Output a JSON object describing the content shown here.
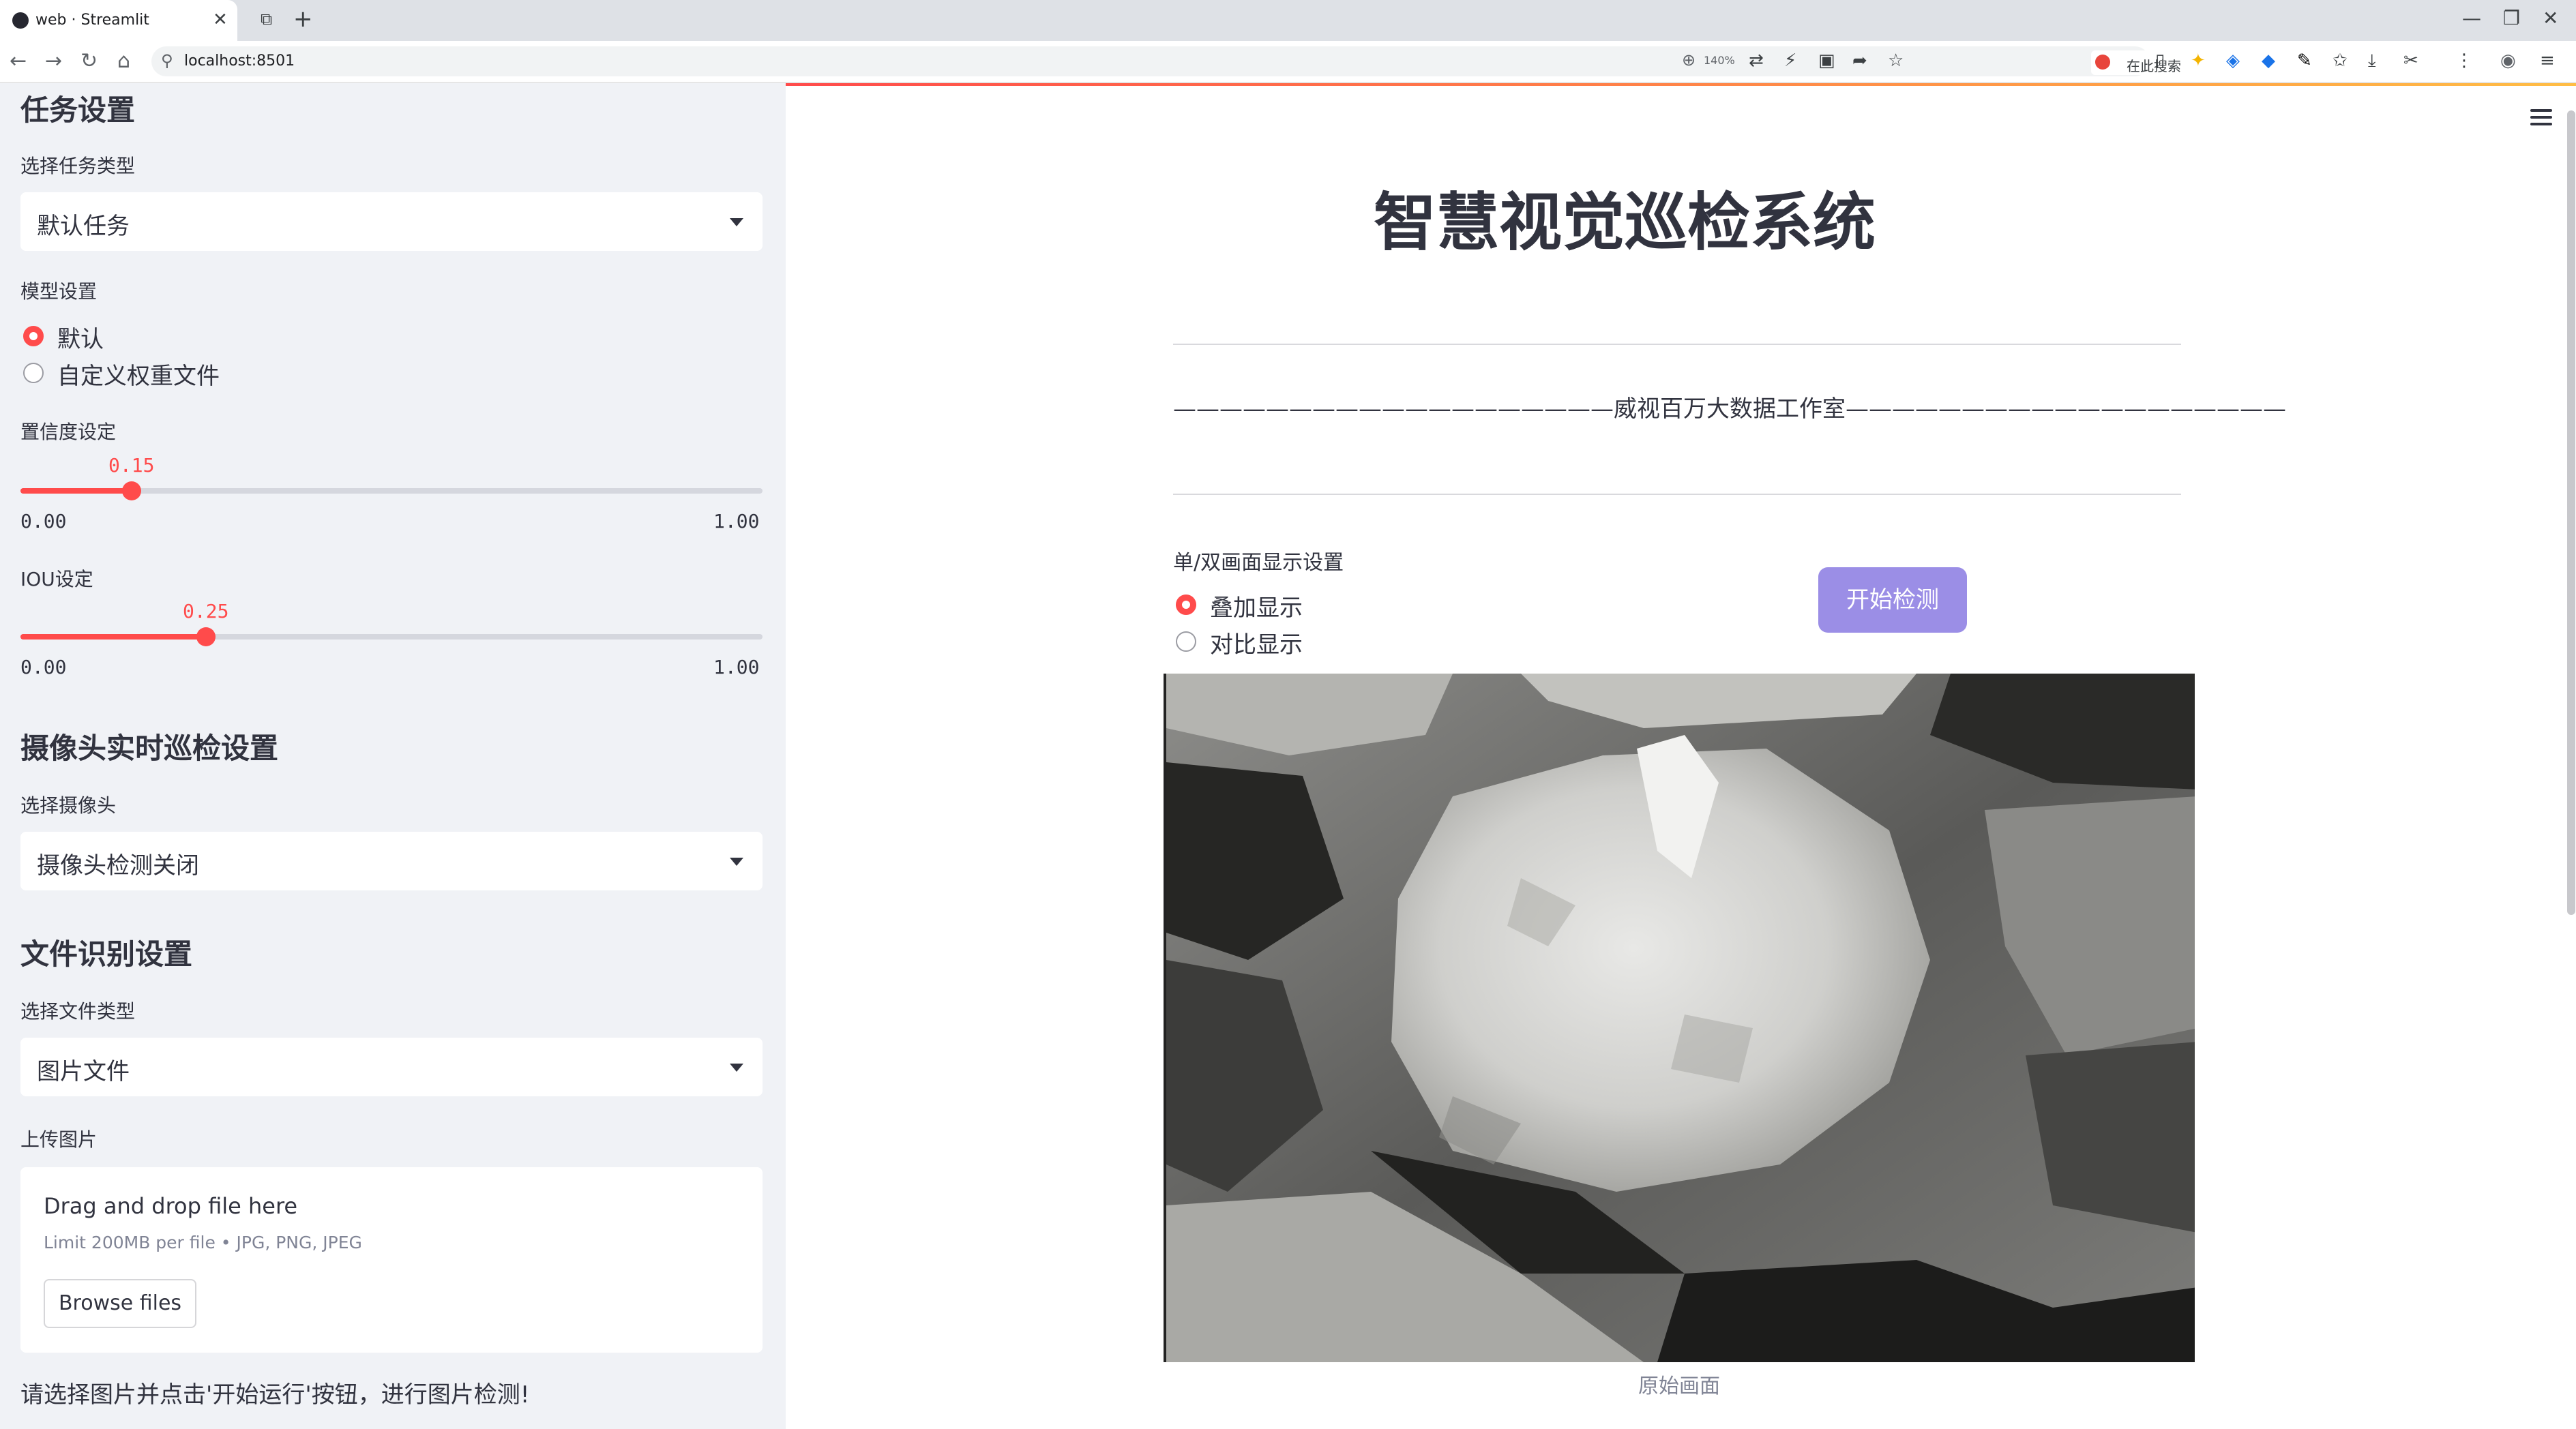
{
  "browser": {
    "tab_title": "web · Streamlit",
    "url": "localhost:8501",
    "zoom": "140%",
    "search_label": "在此搜索"
  },
  "sidebar": {
    "task_section_title": "任务设置",
    "task_type_label": "选择任务类型",
    "task_type_value": "默认任务",
    "model_label": "模型设置",
    "model_options": [
      "默认",
      "自定义权重文件"
    ],
    "model_selected": 0,
    "confidence_label": "置信度设定",
    "confidence": {
      "value": 0.15,
      "value_text": "0.15",
      "min_text": "0.00",
      "max_text": "1.00"
    },
    "iou_label": "IOU设定",
    "iou": {
      "value": 0.25,
      "value_text": "0.25",
      "min_text": "0.00",
      "max_text": "1.00"
    },
    "camera_section_title": "摄像头实时巡检设置",
    "camera_label": "选择摄像头",
    "camera_value": "摄像头检测关闭",
    "file_section_title": "文件识别设置",
    "file_type_label": "选择文件类型",
    "file_type_value": "图片文件",
    "upload_label": "上传图片",
    "uploader": {
      "title": "Drag and drop file here",
      "limit": "Limit 200MB per file • JPG, PNG, JPEG",
      "browse_label": "Browse files"
    },
    "info_text": "请选择图片并点击'开始运行'按钮，进行图片检测!"
  },
  "main": {
    "title": "智慧视觉巡检系统",
    "subtitle": "———————————————————威视百万大数据工作室———————————————————",
    "display_label": "单/双画面显示设置",
    "display_options": [
      "叠加显示",
      "对比显示"
    ],
    "display_selected": 0,
    "start_button": "开始检测",
    "image_caption": "原始画面"
  },
  "colors": {
    "accent": "#ff4b4b",
    "sidebar_bg": "#f0f2f6",
    "button_bg": "#9b8ee6"
  }
}
